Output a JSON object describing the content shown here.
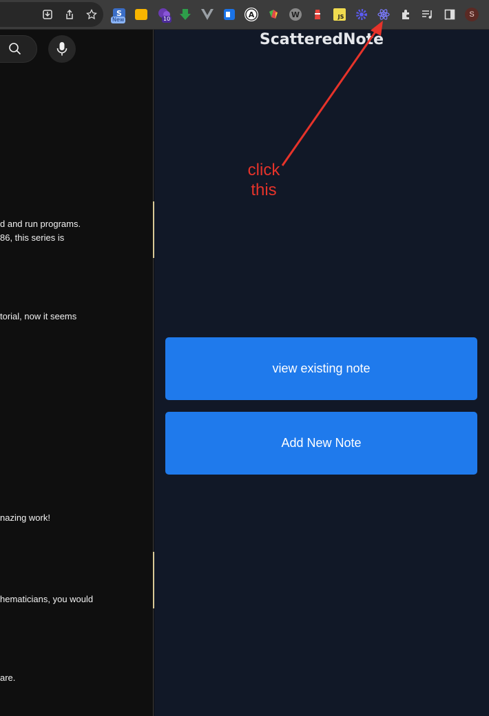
{
  "toolbar": {
    "extensions": [
      {
        "name": "scatterednote-new",
        "badge": "New",
        "color": "#1a73e8"
      },
      {
        "name": "tab-extension",
        "badge": "",
        "color": "#f9b500"
      },
      {
        "name": "purple-blob",
        "badge": "10",
        "color": "#6a3ab2"
      },
      {
        "name": "green-arrow",
        "badge": "",
        "color": "#2e9e4a"
      },
      {
        "name": "vue-devtools",
        "badge": "",
        "color": "#9aa0a6"
      },
      {
        "name": "translate",
        "badge": "",
        "color": "#1a73e8"
      },
      {
        "name": "grammar-a",
        "badge": "",
        "color": "#ffffff"
      },
      {
        "name": "colorful",
        "badge": "",
        "color": "#e04a4a"
      },
      {
        "name": "w-logo",
        "badge": "",
        "color": "#bbbbbb"
      },
      {
        "name": "lighthouse",
        "badge": "",
        "color": "#e8453c"
      },
      {
        "name": "js-logo",
        "badge": "",
        "color": "#f0db4f"
      },
      {
        "name": "gear-purple",
        "badge": "",
        "color": "#5b5bf0"
      },
      {
        "name": "react-devtools",
        "badge": "",
        "color": "#7b7bff"
      }
    ],
    "profile_initial": "S"
  },
  "left_page": {
    "comments": [
      "d and run programs.",
      "86, this series is",
      "torial, now it seems",
      "nazing work!",
      "hematicians, you would",
      "are."
    ]
  },
  "panel": {
    "title": "ScatteredNote",
    "view_button": "view existing note",
    "add_button": "Add New Note"
  },
  "annotation": {
    "line1": "click",
    "line2": "this",
    "color": "#e6332a"
  }
}
